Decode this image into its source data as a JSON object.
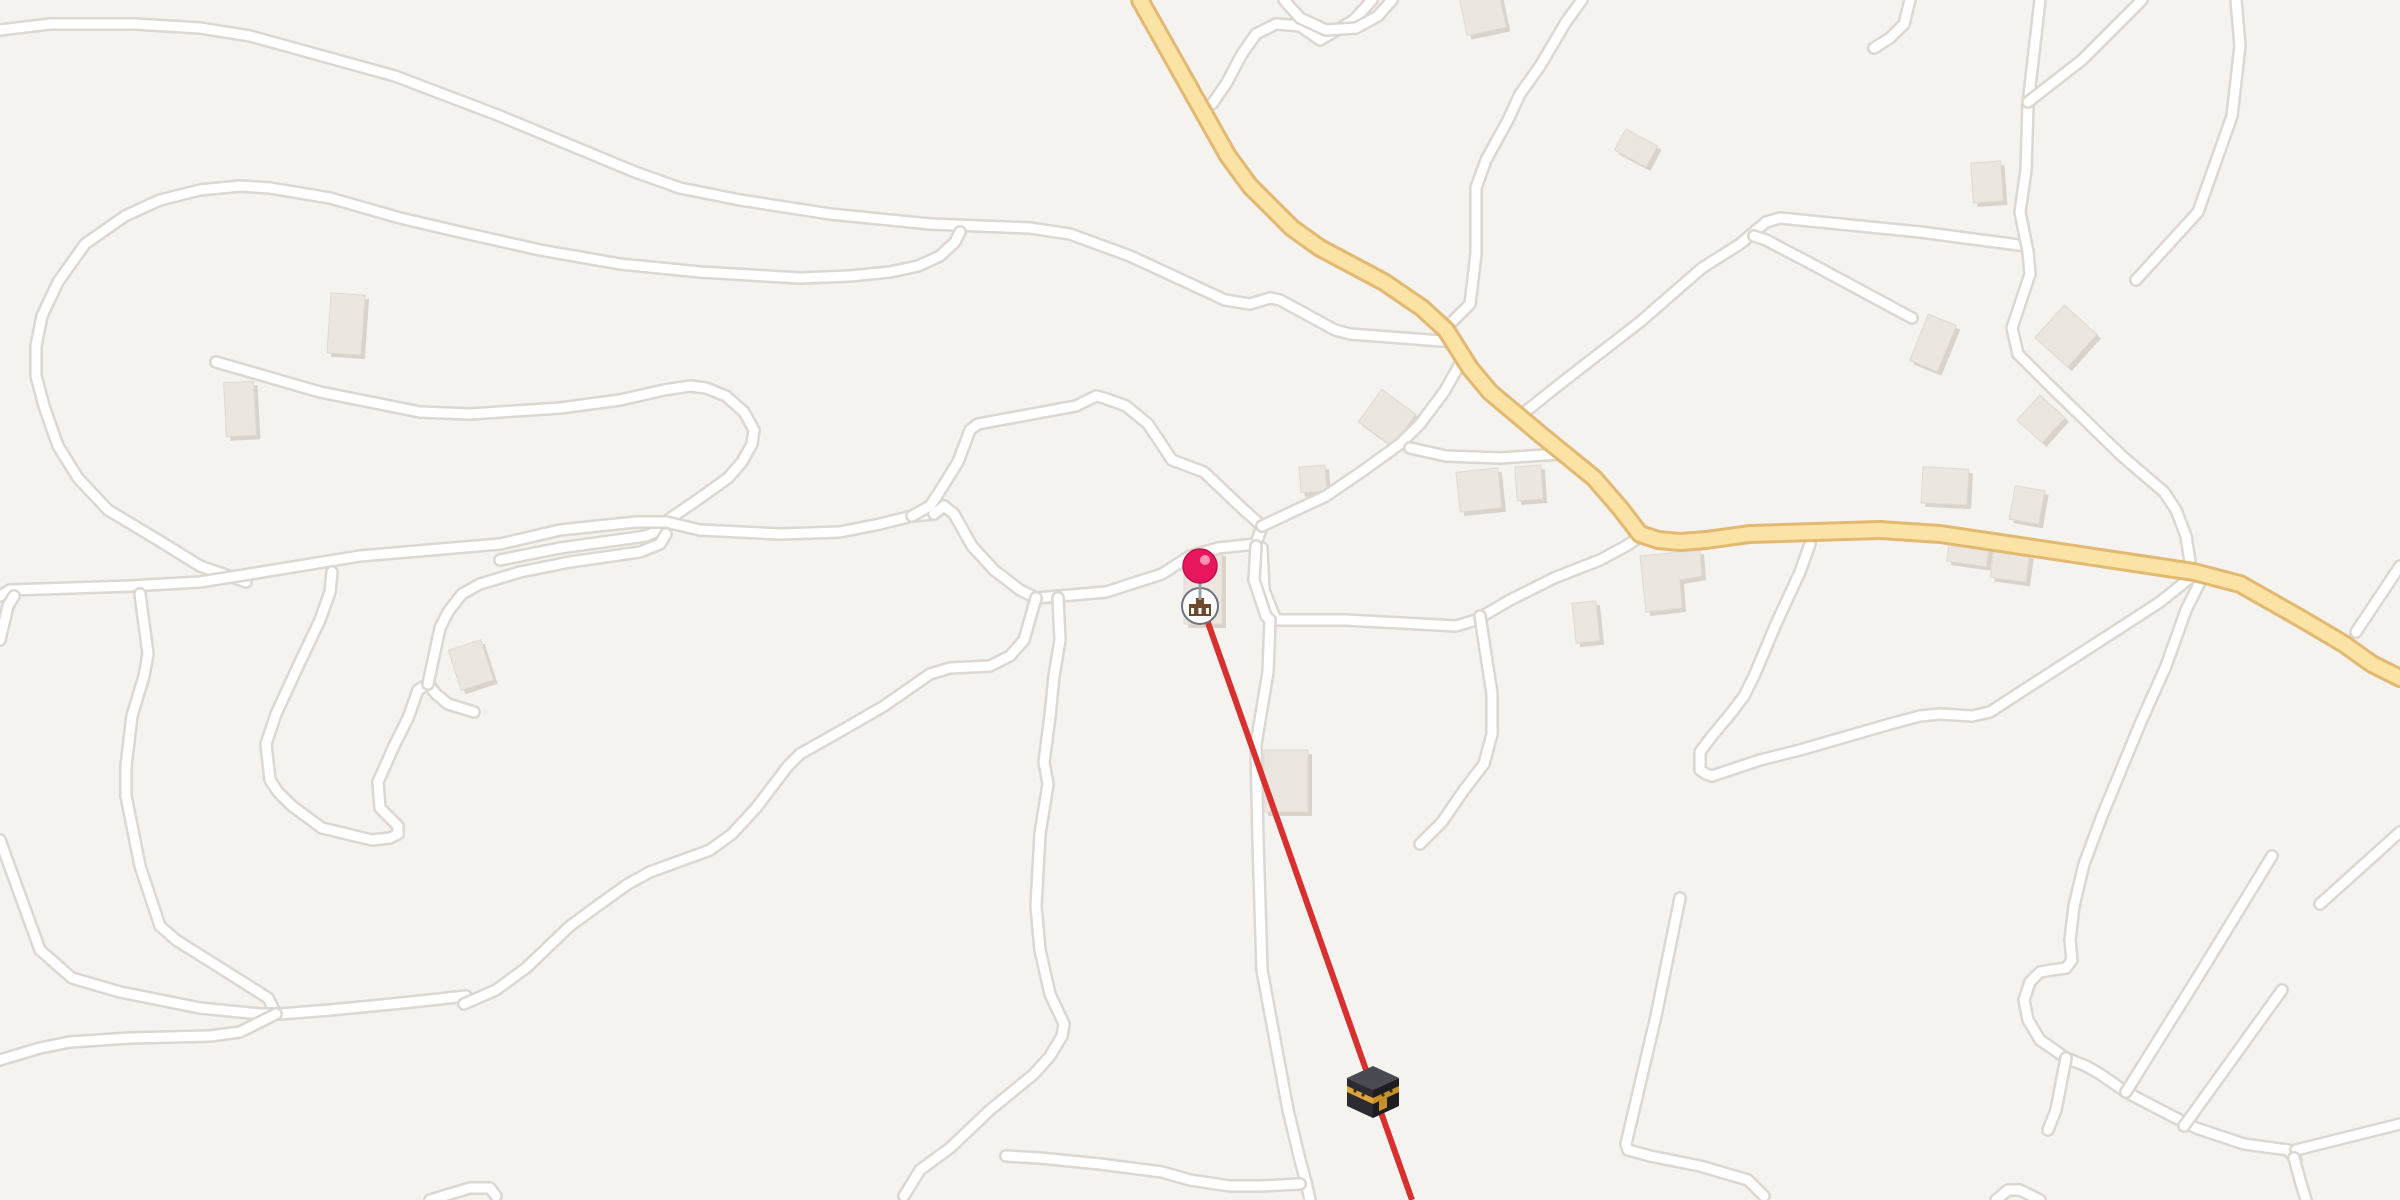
{
  "map": {
    "background_color": "#f5f3f0",
    "road_color": "#ffffff",
    "main_road_color": "#fbe3a5",
    "building_color": "#ebe6e0",
    "qibla_line_color": "#d8302f",
    "pin_color": "#e8175d"
  },
  "markers": {
    "location_pin": {
      "icon": "map-pin-icon"
    },
    "mosque": {
      "icon": "mosque-icon"
    },
    "qibla_direction": {
      "icon": "kaaba-icon"
    }
  }
}
